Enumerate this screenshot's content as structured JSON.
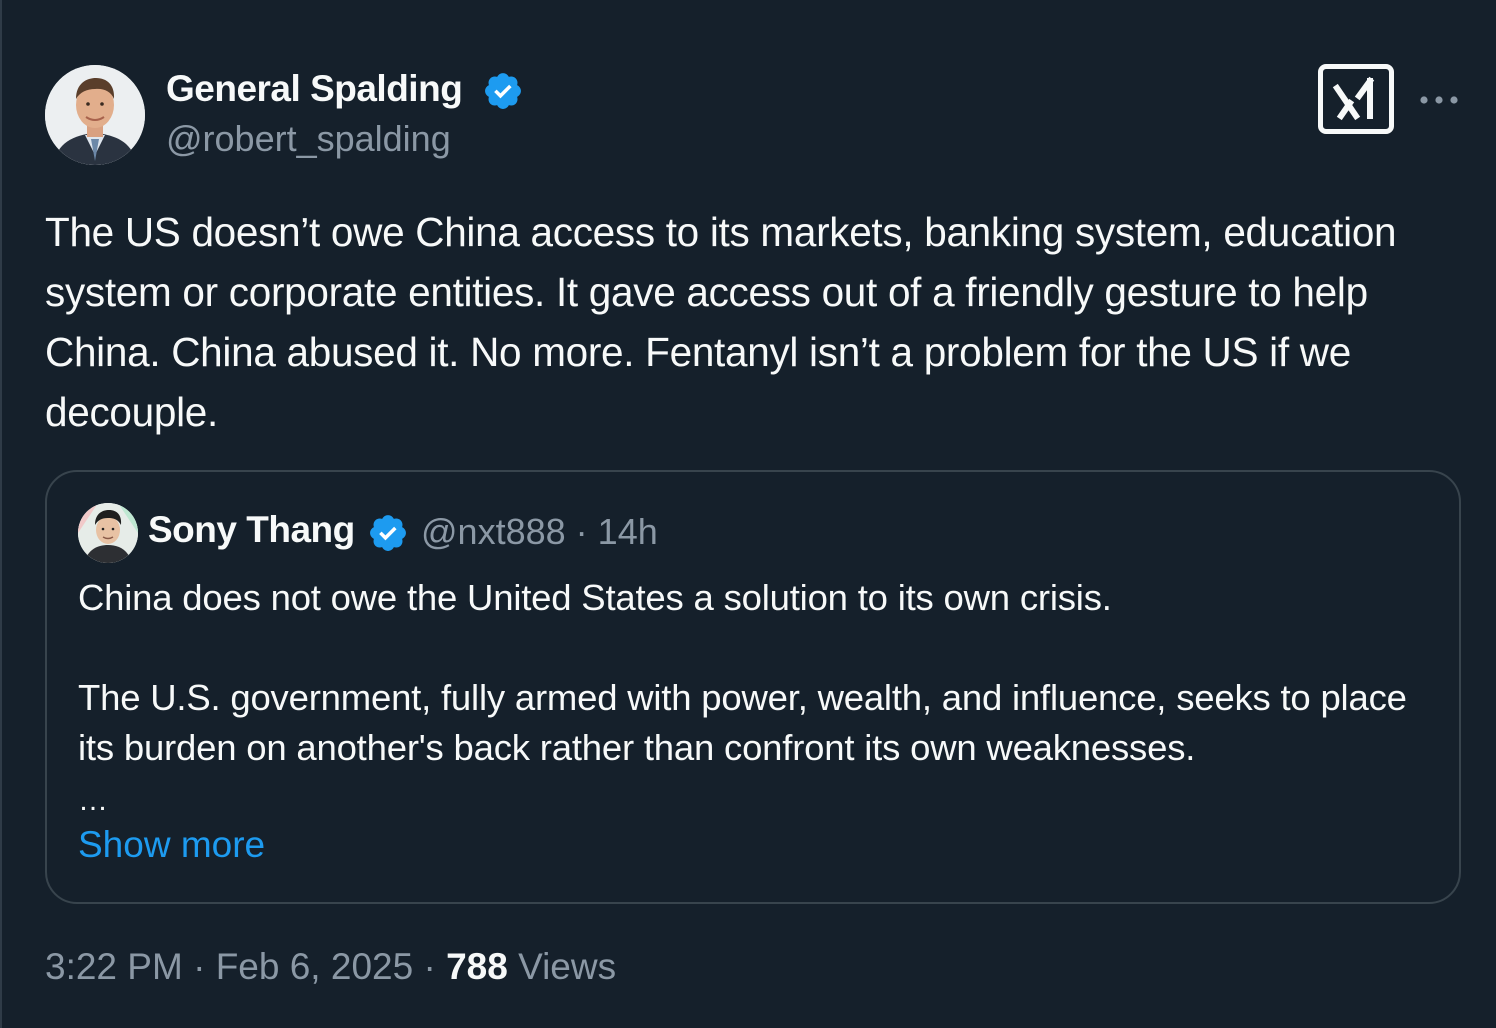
{
  "tweet": {
    "author": {
      "name": "General Spalding",
      "handle": "@robert_spalding",
      "verified": true
    },
    "text": "The US doesn’t owe China access to its markets, banking system, education system or corporate entities. It gave access out of a friendly gesture to help China. China abused it. No more. Fentanyl isn’t a problem for the US if we decouple.",
    "quoted": {
      "author_name": "Sony Thang",
      "handle": "@nxt888",
      "separator": "·",
      "age": "14h",
      "verified": true,
      "paragraph_1": "China does not owe the United States a solution to its own crisis.",
      "paragraph_2": "The U.S. government, fully armed with power, wealth, and influence, seeks to place its burden on another's back rather than confront its own weaknesses.",
      "ellipsis": "…",
      "show_more": "Show more"
    },
    "meta": {
      "time": "3:22 PM",
      "separator": "·",
      "date": "Feb 6, 2025",
      "views_count": "788",
      "views_label": "Views"
    }
  },
  "icons": {
    "verified": "verified-badge-icon",
    "grok": "grok-icon",
    "more": "more-horizontal-icon"
  },
  "colors": {
    "background": "#15202b",
    "text_primary": "#f7f9f9",
    "text_secondary": "#8b98a5",
    "accent": "#1d9bf0",
    "border": "#38444d"
  }
}
